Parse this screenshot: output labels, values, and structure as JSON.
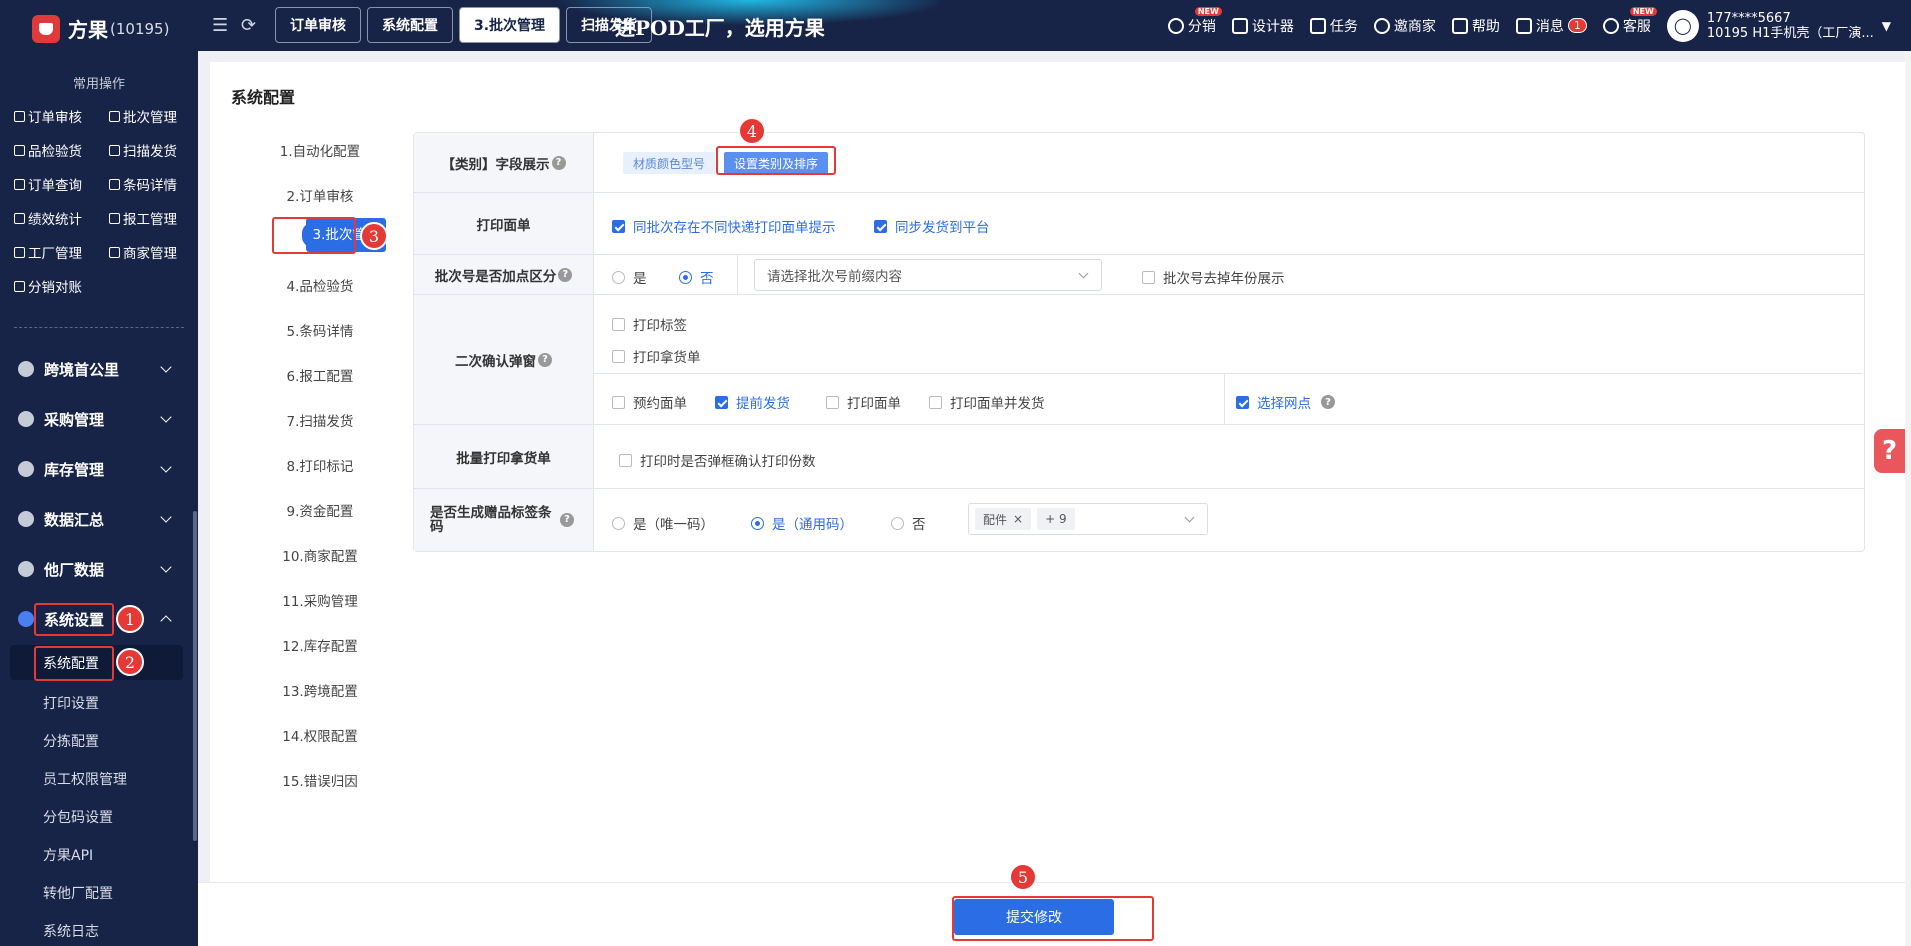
{
  "app": {
    "name": "方果",
    "id": "(10195)"
  },
  "banner": "进POD工厂，选用方果",
  "tabs": [
    {
      "label": "订单审核"
    },
    {
      "label": "系统配置"
    },
    {
      "label": "3.批次管理"
    },
    {
      "label": "扫描发货"
    }
  ],
  "topnav": {
    "fenxiao": "分销",
    "new_tag": "NEW",
    "designer": "设计器",
    "tasks": "任务",
    "invite": "邀商家",
    "help": "帮助",
    "messages": "消息",
    "message_count": "1",
    "service": "客服",
    "user_phone": "177****5667",
    "user_org": "10195 H1手机壳（工厂演..."
  },
  "sidebar": {
    "title": "常用操作",
    "quick": [
      {
        "label": "订单审核"
      },
      {
        "label": "批次管理"
      },
      {
        "label": "品检验货"
      },
      {
        "label": "扫描发货"
      },
      {
        "label": "订单查询"
      },
      {
        "label": "条码详情"
      },
      {
        "label": "绩效统计"
      },
      {
        "label": "报工管理"
      },
      {
        "label": "工厂管理"
      },
      {
        "label": "商家管理"
      },
      {
        "label": "分销对账"
      }
    ],
    "menus": [
      {
        "label": "跨境首公里"
      },
      {
        "label": "采购管理"
      },
      {
        "label": "库存管理"
      },
      {
        "label": "数据汇总"
      },
      {
        "label": "他厂数据"
      },
      {
        "label": "系统设置"
      }
    ],
    "submenus": [
      {
        "label": "系统配置"
      },
      {
        "label": "打印设置"
      },
      {
        "label": "分拣配置"
      },
      {
        "label": "员工权限管理"
      },
      {
        "label": "分包码设置"
      },
      {
        "label": "方果API"
      },
      {
        "label": "转他厂配置"
      },
      {
        "label": "系统日志"
      }
    ]
  },
  "page": {
    "title": "系统配置",
    "left_nav": [
      {
        "label": "1.自动化配置"
      },
      {
        "label": "2.订单审核"
      },
      {
        "label": "3.批次管理"
      },
      {
        "label": "4.品检验货"
      },
      {
        "label": "5.条码详情"
      },
      {
        "label": "6.报工配置"
      },
      {
        "label": "7.扫描发货"
      },
      {
        "label": "8.打印标记"
      },
      {
        "label": "9.资金配置"
      },
      {
        "label": "10.商家配置"
      },
      {
        "label": "11.采购管理"
      },
      {
        "label": "12.库存配置"
      },
      {
        "label": "13.跨境配置"
      },
      {
        "label": "14.权限配置"
      },
      {
        "label": "15.错误归因"
      }
    ]
  },
  "form": {
    "category": {
      "label": "【类别】字段展示",
      "tag1": "材质颜色型号",
      "tag2": "设置类别及排序"
    },
    "print_sheet": {
      "label": "打印面单",
      "opt1": "同批次存在不同快递打印面单提示",
      "opt2": "同步发货到平台"
    },
    "batch_dot": {
      "label": "批次号是否加点区分",
      "yes": "是",
      "no": "否",
      "select_placeholder": "请选择批次号前缀内容",
      "remove_year": "批次号去掉年份展示"
    },
    "confirm_popup": {
      "label": "二次确认弹窗",
      "print_label": "打印标签",
      "print_pick": "打印拿货单",
      "reserve_sheet": "预约面单",
      "early_ship": "提前发货",
      "print_sheet": "打印面单",
      "print_and_ship": "打印面单并发货",
      "select_outlet": "选择网点"
    },
    "bulk_pick": {
      "label": "批量打印拿货单",
      "opt": "打印时是否弹框确认打印份数"
    },
    "gift_label": {
      "label": "是否生成赠品标签条码",
      "opt_unique": "是（唯一码）",
      "opt_generic": "是（通用码）",
      "opt_no": "否",
      "chip1": "配件",
      "chip_more": "+ 9"
    }
  },
  "footer": {
    "submit": "提交修改"
  },
  "steps": [
    "1",
    "2",
    "3",
    "4",
    "5"
  ],
  "help_float": "?"
}
